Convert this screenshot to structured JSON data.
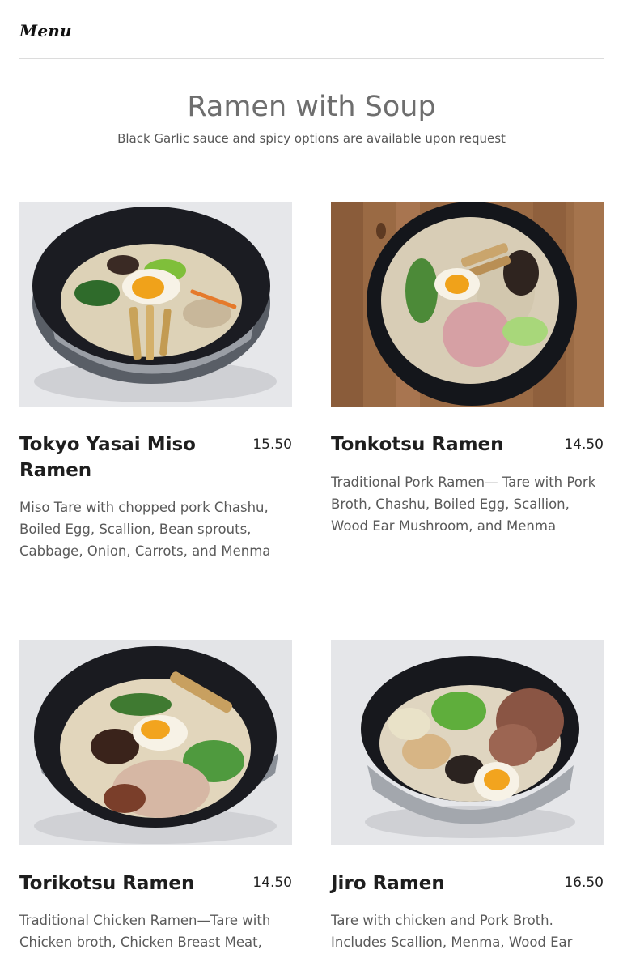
{
  "header": {
    "menu_label": "Menu"
  },
  "section": {
    "title": "Ramen with Soup",
    "subtitle": "Black Garlic sauce and spicy options are available upon request"
  },
  "items": [
    {
      "name": "Tokyo Yasai Miso Ramen",
      "price": "15.50",
      "description": "Miso Tare with chopped pork Chashu, Boiled Egg, Scallion, Bean sprouts, Cabbage, Onion, Carrots, and Menma"
    },
    {
      "name": "Tonkotsu Ramen",
      "price": "14.50",
      "description": "Traditional Pork Ramen— Tare with Pork Broth, Chashu, Boiled Egg, Scallion, Wood Ear Mushroom, and Menma"
    },
    {
      "name": "Torikotsu Ramen",
      "price": "14.50",
      "description": "Traditional Chicken Ramen—Tare with Chicken broth, Chicken Breast Meat,"
    },
    {
      "name": "Jiro Ramen",
      "price": "16.50",
      "description": "Tare with chicken and Pork Broth. Includes Scallion, Menma, Wood Ear"
    }
  ],
  "colors": {
    "text_primary": "#1e1e1e",
    "text_secondary": "#5a5a5a",
    "title_gray": "#6e6e6e",
    "divider": "#dcdcdc"
  }
}
